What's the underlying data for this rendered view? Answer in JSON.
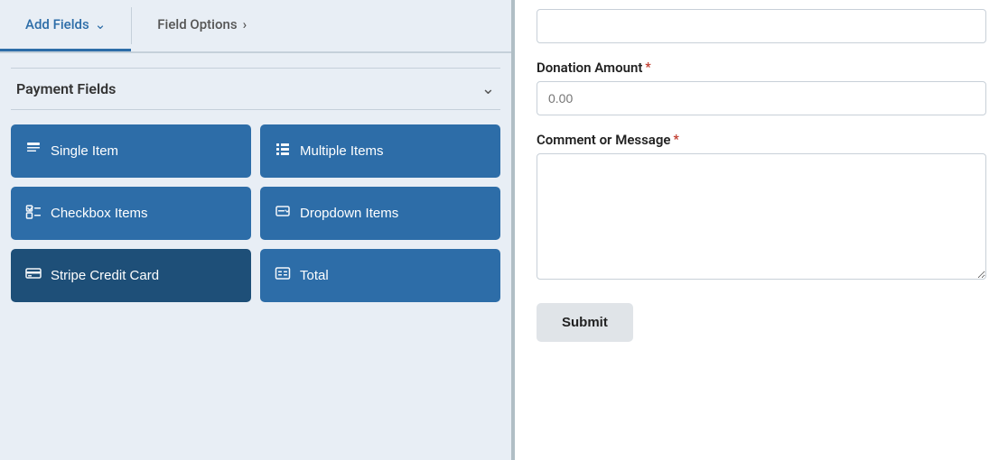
{
  "tabs": {
    "add_fields": {
      "label": "Add Fields",
      "active": true
    },
    "field_options": {
      "label": "Field Options",
      "active": false
    }
  },
  "payment_fields": {
    "section_title": "Payment Fields",
    "buttons": [
      {
        "id": "single-item",
        "label": "Single Item",
        "icon": "📄",
        "dark": false
      },
      {
        "id": "multiple-items",
        "label": "Multiple Items",
        "icon": "≡",
        "dark": false
      },
      {
        "id": "checkbox-items",
        "label": "Checkbox Items",
        "icon": "☑",
        "dark": false
      },
      {
        "id": "dropdown-items",
        "label": "Dropdown Items",
        "icon": "⊡",
        "dark": false
      },
      {
        "id": "stripe-credit-card",
        "label": "Stripe Credit Card",
        "icon": "💳",
        "dark": true
      },
      {
        "id": "total",
        "label": "Total",
        "icon": "⊞",
        "dark": false
      }
    ]
  },
  "form": {
    "top_input_placeholder": "",
    "donation_amount": {
      "label": "Donation Amount",
      "required": true,
      "placeholder": "0.00"
    },
    "comment_message": {
      "label": "Comment or Message",
      "required": true,
      "placeholder": ""
    },
    "submit_button": "Submit"
  }
}
